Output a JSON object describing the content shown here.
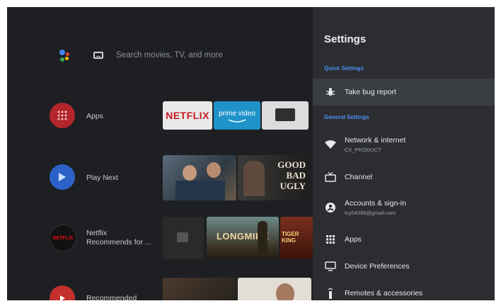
{
  "search": {
    "placeholder": "Search movies, TV, and more"
  },
  "rows": [
    {
      "label": "Apps"
    },
    {
      "label": "Play Next"
    },
    {
      "label": "Netflix\nRecommends for ...",
      "icon_text": "NETFLIX"
    },
    {
      "label": "Recommended"
    }
  ],
  "apps_row": [
    {
      "name": "NETFLIX"
    },
    {
      "name": "prime video"
    },
    {
      "name": "tv"
    }
  ],
  "play_next_row": [
    {
      "name": "movie-poster"
    },
    {
      "name": "GOOD\nBAD\nUGLY"
    }
  ],
  "netflix_row": [
    {
      "name": "LONGMIRE"
    },
    {
      "name": "TIGER KING"
    }
  ],
  "settings": {
    "title": "Settings",
    "quick_section": "Quick Settings",
    "general_section": "General Settings",
    "items": [
      {
        "label": "Take bug report",
        "icon": "bug-icon"
      },
      {
        "label": "Network & internet",
        "sub": "CX_PRODUCT",
        "icon": "wifi-icon"
      },
      {
        "label": "Channel",
        "icon": "tv-icon"
      },
      {
        "label": "Accounts & sign-in",
        "sub": "luy04396@gmail.com",
        "icon": "account-icon"
      },
      {
        "label": "Apps",
        "icon": "apps-grid-icon"
      },
      {
        "label": "Device Preferences",
        "icon": "monitor-icon"
      },
      {
        "label": "Remotes & accessories",
        "icon": "remote-icon"
      }
    ]
  },
  "colors": {
    "accent": "#4f8ff2",
    "panel": "#2b2d31",
    "background": "#1d1f22"
  }
}
